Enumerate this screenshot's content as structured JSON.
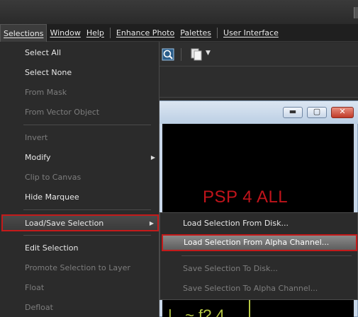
{
  "menubar": {
    "items": [
      "Selections",
      "Window",
      "Help",
      "Enhance Photo",
      "Palettes",
      "User Interface"
    ]
  },
  "selections_menu": {
    "items": [
      {
        "label": "Select All",
        "enabled": true
      },
      {
        "label": "Select None",
        "enabled": true
      },
      {
        "label": "From Mask",
        "enabled": false
      },
      {
        "label": "From Vector Object",
        "enabled": false
      },
      {
        "label": "Invert",
        "enabled": false
      },
      {
        "label": "Modify",
        "enabled": true,
        "submenu": true
      },
      {
        "label": "Clip to Canvas",
        "enabled": false
      },
      {
        "label": "Hide Marquee",
        "enabled": true
      },
      {
        "label": "Load/Save Selection",
        "enabled": true,
        "submenu": true,
        "highlighted": true
      },
      {
        "label": "Edit Selection",
        "enabled": true
      },
      {
        "label": "Promote Selection to Layer",
        "enabled": false
      },
      {
        "label": "Float",
        "enabled": false
      },
      {
        "label": "Defloat",
        "enabled": false
      }
    ]
  },
  "load_save_submenu": {
    "items": [
      {
        "label": "Load Selection From Disk...",
        "enabled": true
      },
      {
        "label": "Load Selection From Alpha Channel...",
        "enabled": true,
        "highlighted": true
      },
      {
        "label": "Save Selection To Disk...",
        "enabled": false
      },
      {
        "label": "Save Selection To Alpha Channel...",
        "enabled": false
      }
    ]
  },
  "image_window": {
    "canvas_text": "PSP 4 ALL",
    "canvas_partial_text": "|_ ~ f? 4",
    "buttons": {
      "minimize": "▬",
      "maximize": "▢",
      "close": "✕"
    }
  },
  "colors": {
    "highlight_border": "#c41a1a",
    "canvas_text": "#c0141b",
    "canvas_bg": "#000000",
    "menu_bg": "#2b2b2b"
  },
  "icons": [
    "zoom-fit-icon",
    "document-icon",
    "dropdown-caret-icon",
    "submenu-arrow-icon"
  ]
}
